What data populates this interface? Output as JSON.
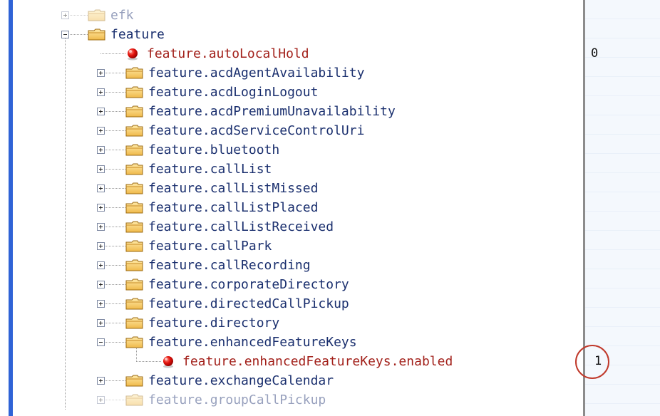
{
  "tree": {
    "rows": [
      {
        "label": "efk",
        "kind": "folder",
        "toggle": "plus",
        "level": 0,
        "faded": true
      },
      {
        "label": "feature",
        "kind": "folder",
        "toggle": "minus",
        "level": 0,
        "faded": false
      },
      {
        "label": "feature.autoLocalHold",
        "kind": "leaf",
        "level": 1,
        "value": "0"
      },
      {
        "label": "feature.acdAgentAvailability",
        "kind": "folder",
        "toggle": "plus",
        "level": 1
      },
      {
        "label": "feature.acdLoginLogout",
        "kind": "folder",
        "toggle": "plus",
        "level": 1
      },
      {
        "label": "feature.acdPremiumUnavailability",
        "kind": "folder",
        "toggle": "plus",
        "level": 1
      },
      {
        "label": "feature.acdServiceControlUri",
        "kind": "folder",
        "toggle": "plus",
        "level": 1
      },
      {
        "label": "feature.bluetooth",
        "kind": "folder",
        "toggle": "plus",
        "level": 1
      },
      {
        "label": "feature.callList",
        "kind": "folder",
        "toggle": "plus",
        "level": 1
      },
      {
        "label": "feature.callListMissed",
        "kind": "folder",
        "toggle": "plus",
        "level": 1
      },
      {
        "label": "feature.callListPlaced",
        "kind": "folder",
        "toggle": "plus",
        "level": 1
      },
      {
        "label": "feature.callListReceived",
        "kind": "folder",
        "toggle": "plus",
        "level": 1
      },
      {
        "label": "feature.callPark",
        "kind": "folder",
        "toggle": "plus",
        "level": 1
      },
      {
        "label": "feature.callRecording",
        "kind": "folder",
        "toggle": "plus",
        "level": 1
      },
      {
        "label": "feature.corporateDirectory",
        "kind": "folder",
        "toggle": "plus",
        "level": 1
      },
      {
        "label": "feature.directedCallPickup",
        "kind": "folder",
        "toggle": "plus",
        "level": 1
      },
      {
        "label": "feature.directory",
        "kind": "folder",
        "toggle": "plus",
        "level": 1
      },
      {
        "label": "feature.enhancedFeatureKeys",
        "kind": "folder",
        "toggle": "minus",
        "level": 1
      },
      {
        "label": "feature.enhancedFeatureKeys.enabled",
        "kind": "leaf",
        "level": 2,
        "value": "1",
        "highlighted": true
      },
      {
        "label": "feature.exchangeCalendar",
        "kind": "folder",
        "toggle": "plus",
        "level": 1
      },
      {
        "label": "feature.groupCallPickup",
        "kind": "folder",
        "toggle": "plus",
        "level": 1,
        "faded": true
      }
    ]
  },
  "colors": {
    "folder_label": "#1a2f6e",
    "leaf_label": "#a2201a",
    "highlight_circle": "#c0392b",
    "left_bar": "#2f63d6"
  },
  "icons": {
    "folder": "folder-icon",
    "leaf": "red-ball-icon",
    "expand": "plus-box-icon",
    "collapse": "minus-box-icon"
  }
}
